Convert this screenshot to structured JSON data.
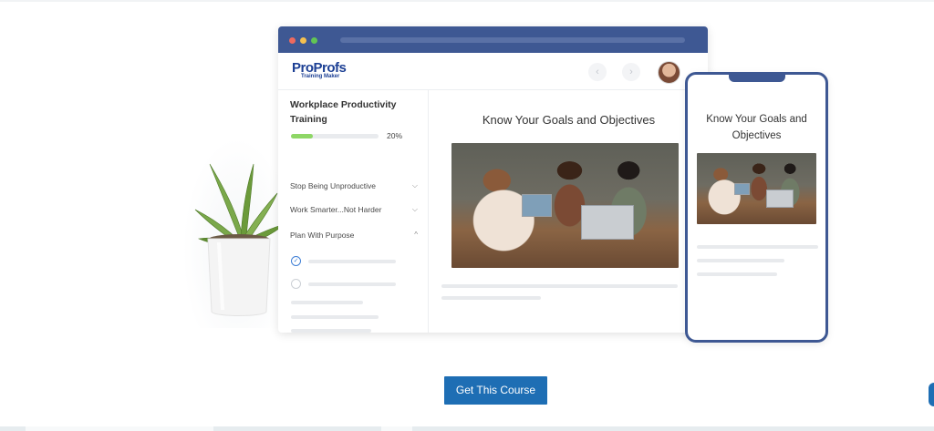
{
  "browser": {
    "logo": {
      "text_pro": "Pro",
      "text_profs": "Profs",
      "subtitle": "Training Maker"
    },
    "nav": {
      "prev_icon": "chevron-left-icon",
      "next_icon": "chevron-right-icon"
    },
    "sidebar": {
      "course_title": "Workplace Productivity Training",
      "progress_percent": 20,
      "progress_label": "20%",
      "modules": [
        {
          "label": "Stop Being Unproductive",
          "icon": "chevron-down-icon"
        },
        {
          "label": "Work Smarter...Not Harder",
          "icon": "chevron-down-icon"
        },
        {
          "label": "Plan With Purpose",
          "icon": "chevron-up-icon"
        }
      ]
    },
    "content": {
      "title": "Know Your Goals and Objectives"
    }
  },
  "phone": {
    "title": "Know Your Goals and Objectives"
  },
  "cta": {
    "label": "Get This Course"
  },
  "colors": {
    "brand_navy": "#3e5893",
    "cta_blue": "#1e6eb4",
    "progress_green": "#8ed766"
  }
}
